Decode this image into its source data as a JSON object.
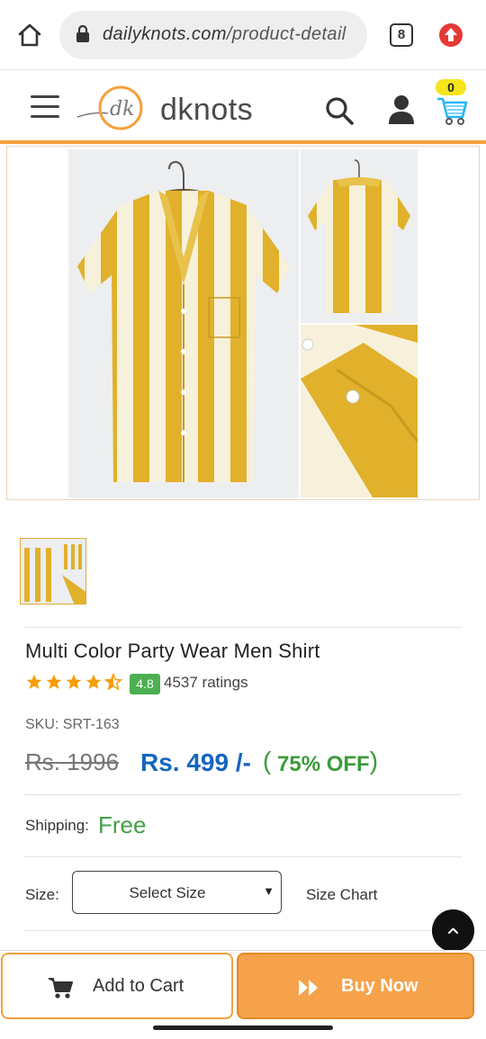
{
  "browser": {
    "url_domain": "dailyknots.com",
    "url_path": "/product-detail",
    "tab_count": "8",
    "icons": {
      "home": "home-icon",
      "lock": "lock-icon",
      "extension": "upload-arrow-icon"
    }
  },
  "header": {
    "logo_text": "dknots",
    "cart_count": "0",
    "accent_color": "#f5a03c",
    "icons": {
      "menu": "hamburger-menu-icon",
      "search": "search-icon",
      "user": "user-icon",
      "cart": "cart-icon"
    }
  },
  "product": {
    "title": "Multi Color Party Wear Men Shirt",
    "rating_value": "4.8",
    "rating_stars": 4.5,
    "ratings_count": "4537 ratings",
    "sku": "SKU: SRT-163",
    "old_price": "Rs. 1996",
    "new_price": "Rs. 499 /-",
    "discount": "75% OFF",
    "shipping_label": "Shipping:",
    "shipping_value": "Free",
    "size_label": "Size:",
    "size_select_value": "Select Size",
    "size_chart": "Size Chart"
  },
  "actions": {
    "add_to_cart": "Add to Cart",
    "buy_now": "Buy Now"
  },
  "colors": {
    "price_blue": "#1565c0",
    "discount_green": "#3a9b3a",
    "rating_badge_green": "#4caf50",
    "buy_now_orange": "#f5a24b",
    "shirt_yellow": "#e1b12c"
  }
}
